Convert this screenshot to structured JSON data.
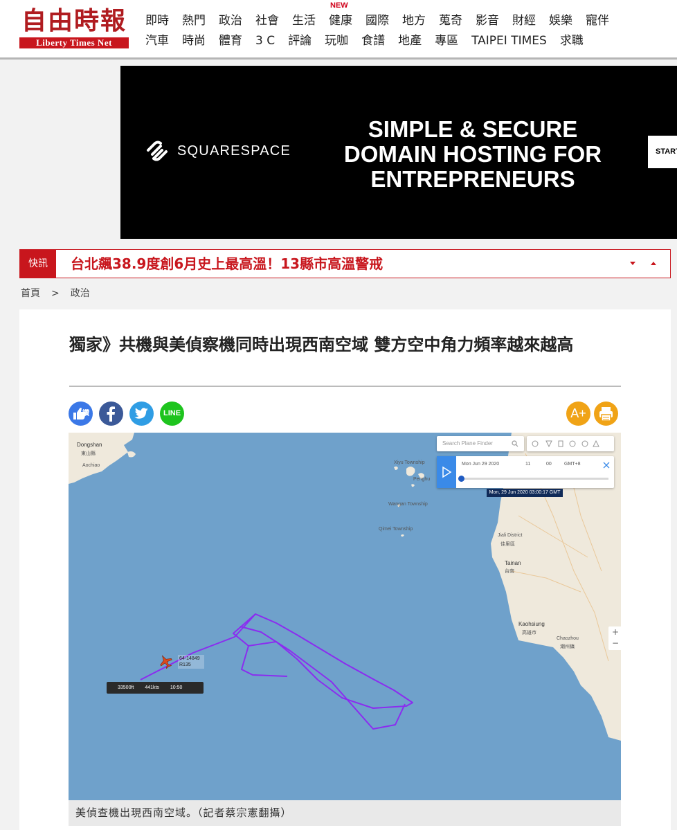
{
  "header": {
    "logo_cn": "自由時報",
    "logo_en": "Liberty Times Net",
    "nav_row1": [
      "即時",
      "熱門",
      "政治",
      "社會",
      "生活",
      "健康",
      "國際",
      "地方",
      "蒐奇",
      "影音",
      "財經",
      "娛樂",
      "寵伴"
    ],
    "nav_row2": [
      "汽車",
      "時尚",
      "體育",
      "3 C",
      "評論",
      "玩咖",
      "食譜",
      "地產",
      "專區",
      "TAIPEI TIMES",
      "求職"
    ],
    "new_badge": "NEW"
  },
  "ad": {
    "brand": "SQUARESPACE",
    "headline_lines": [
      "SIMPLE & SECURE",
      "DOMAIN HOSTING FOR",
      "ENTREPRENEURS"
    ],
    "cta": "START"
  },
  "ticker": {
    "label": "快訊",
    "text": "台北飆38.9度創6月史上最高溫！13縣市高溫警戒"
  },
  "breadcrumb": [
    "首頁",
    ">",
    "政治"
  ],
  "article": {
    "title": "獨家》共機與美偵察機同時出現西南空域 雙方空中角力頻率越來越高",
    "share": {
      "like": "讚",
      "line": "LINE"
    },
    "tools": {
      "font_size": "A+"
    },
    "caption": "美偵查機出現西南空域。（記者蔡宗憲翻攝）"
  },
  "map": {
    "places": [
      "Dongshan",
      "東山縣",
      "Aochiao",
      "Xiyu Township",
      "Wangan Township",
      "Qimei Township",
      "Jiali District",
      "佳里區",
      "Tainan",
      "台南",
      "Kaohsiung",
      "高雄市",
      "Chaozhou",
      "潮州鎮",
      "Penghu"
    ],
    "flight_search_placeholder": "Search Plane Finder",
    "date_value": "Mon Jun 29 2020",
    "hour_value": "11",
    "minute_value": "00",
    "timezone": "GMT+8",
    "timestamp": "Mon, 29 Jun 2020 03:00:17 GMT",
    "callsign_line1": "64-14849",
    "callsign_line2": "R135",
    "altitude": "33500ft",
    "speed": "441kts",
    "time": "10:50"
  },
  "colors": {
    "brand_red": "#c8161d",
    "track_purple": "#8b2cf0",
    "sea_blue": "#6fa1cb",
    "land": "#f0ebe0",
    "accent_orange": "#f0a316"
  }
}
